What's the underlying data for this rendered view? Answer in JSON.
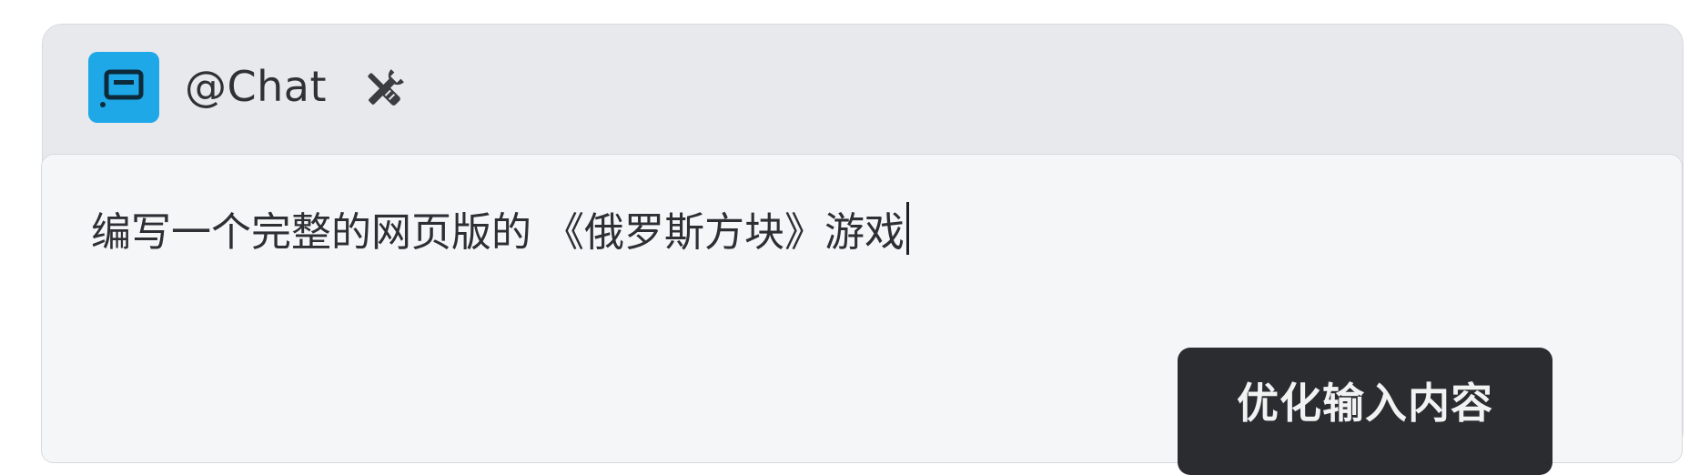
{
  "header": {
    "app_icon": "chat-bubble-icon",
    "title": "@Chat",
    "tools_icon": "tools-icon"
  },
  "input": {
    "value": "编写一个完整的网页版的 《俄罗斯方块》游戏"
  },
  "tooltip": {
    "label": "优化输入内容"
  },
  "colors": {
    "accent": "#1fa8e8",
    "header_bg": "#e8e9ec",
    "input_bg": "#f5f6f8",
    "tooltip_bg": "#2a2c30"
  }
}
